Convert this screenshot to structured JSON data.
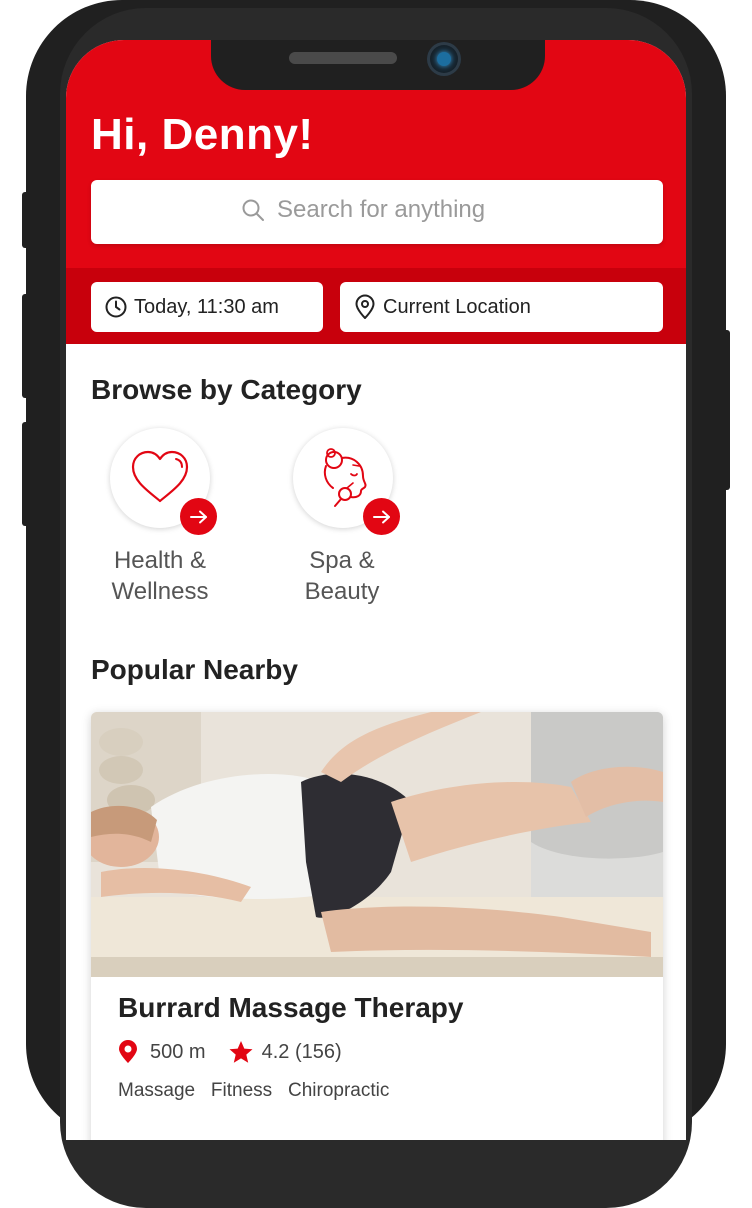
{
  "header": {
    "greeting": "Hi, Denny!",
    "search_placeholder": "Search for anything",
    "time_filter": "Today, 11:30 am",
    "location_filter": "Current Location",
    "brand_color": "#e20613"
  },
  "categories_section": {
    "title": "Browse by Category",
    "items": [
      {
        "line1": "Health &",
        "line2": "Wellness",
        "icon": "heart-icon"
      },
      {
        "line1": "Spa &",
        "line2": "Beauty",
        "icon": "spa-face-icon"
      }
    ]
  },
  "popular_section": {
    "title": "Popular Nearby",
    "cards": [
      {
        "name": "Burrard Massage Therapy",
        "distance": "500 m",
        "rating": "4.2 (156)",
        "tags": "Massage   Fitness   Chiropractic",
        "image": "massage-therapy-photo"
      }
    ]
  }
}
